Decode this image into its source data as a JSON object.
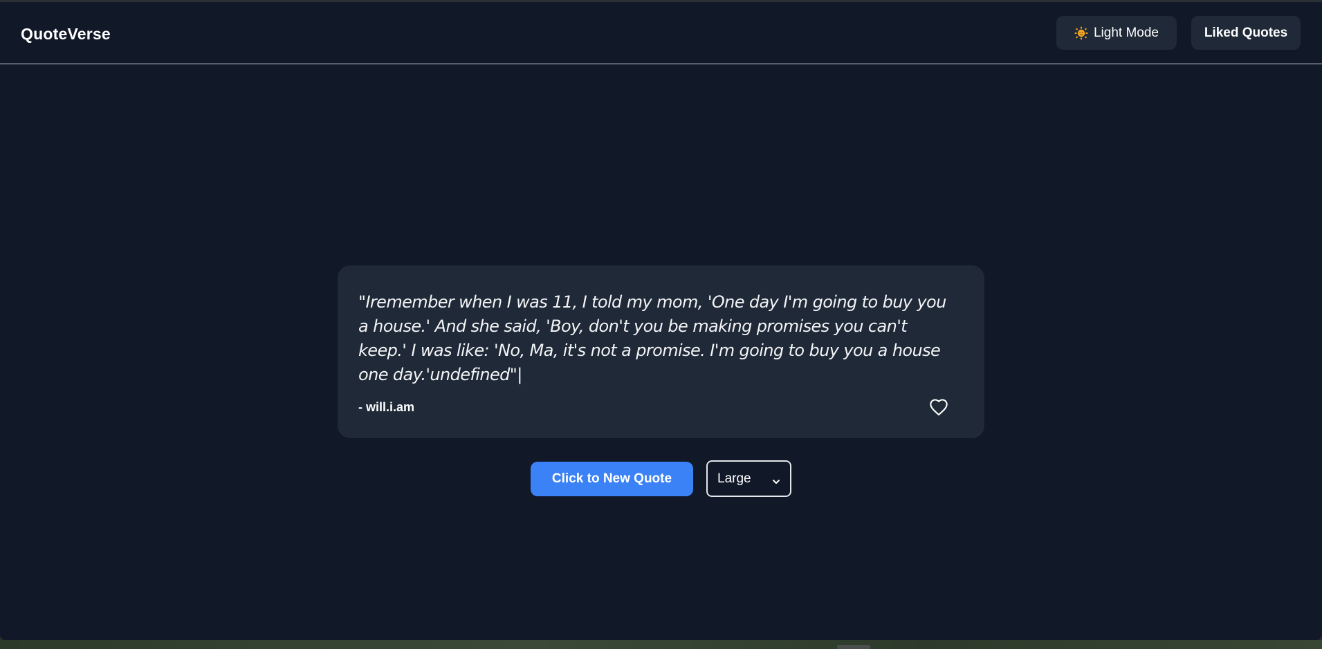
{
  "app": {
    "title": "QuoteVerse"
  },
  "header": {
    "light_mode_label": "Light Mode",
    "light_mode_icon": "sun-face-icon",
    "liked_quotes_label": "Liked Quotes"
  },
  "quote": {
    "text": "\"Iremember when I was 11, I told my mom, 'One day I'm going to buy you a house.' And she said, 'Boy, don't you be making promises you can't keep.' I was like: 'No, Ma, it's not a promise. I'm going to buy you a house one day.'undefined\"",
    "cursor": "|",
    "author": "- will.i.am",
    "like_icon": "heart-outline-icon",
    "liked": false
  },
  "controls": {
    "new_quote_label": "Click to New Quote",
    "font_size_selected": "Large"
  },
  "colors": {
    "background": "#111827",
    "card": "#1f2937",
    "accent": "#3b82f6",
    "text": "#ffffff"
  }
}
